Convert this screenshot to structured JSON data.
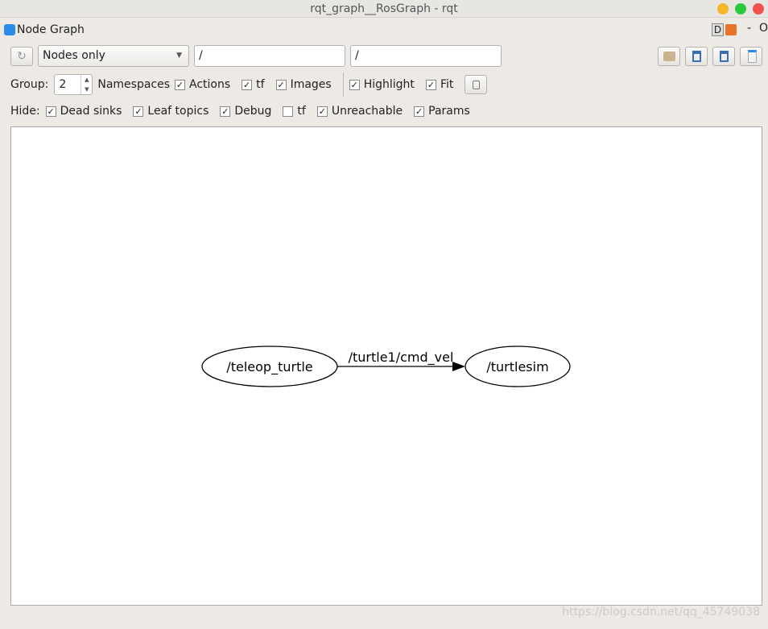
{
  "window": {
    "title": "rqt_graph__RosGraph - rqt",
    "colors": {
      "minimize": "#f5b82b",
      "maximize": "#2ec840",
      "close": "#f0524f"
    }
  },
  "plugin": {
    "title": "Node Graph",
    "d_label": "D",
    "dash": "-",
    "o_label": "O"
  },
  "toolbar": {
    "refresh_icon": "refresh-icon",
    "mode": "Nodes only",
    "node_filter": "/",
    "topic_filter": "/",
    "icons": [
      "load-dot-icon",
      "save-dot-icon",
      "save-svg-icon",
      "save-image-icon"
    ]
  },
  "options": {
    "group_label": "Group:",
    "group_value": "2",
    "namespaces": "Namespaces",
    "actions": {
      "label": "Actions",
      "checked": true
    },
    "tf": {
      "label": "tf",
      "checked": true
    },
    "images": {
      "label": "Images",
      "checked": true
    },
    "highlight": {
      "label": "Highlight",
      "checked": true
    },
    "fit": {
      "label": "Fit",
      "checked": true
    }
  },
  "hide": {
    "label": "Hide:",
    "items": [
      {
        "label": "Dead sinks",
        "checked": true
      },
      {
        "label": "Leaf topics",
        "checked": true
      },
      {
        "label": "Debug",
        "checked": true
      },
      {
        "label": "tf",
        "checked": false
      },
      {
        "label": "Unreachable",
        "checked": true
      },
      {
        "label": "Params",
        "checked": true
      }
    ]
  },
  "graph": {
    "nodes": [
      "/teleop_turtle",
      "/turtlesim"
    ],
    "edge_label": "/turtle1/cmd_vel"
  },
  "watermark": "https://blog.csdn.net/qq_45749038"
}
